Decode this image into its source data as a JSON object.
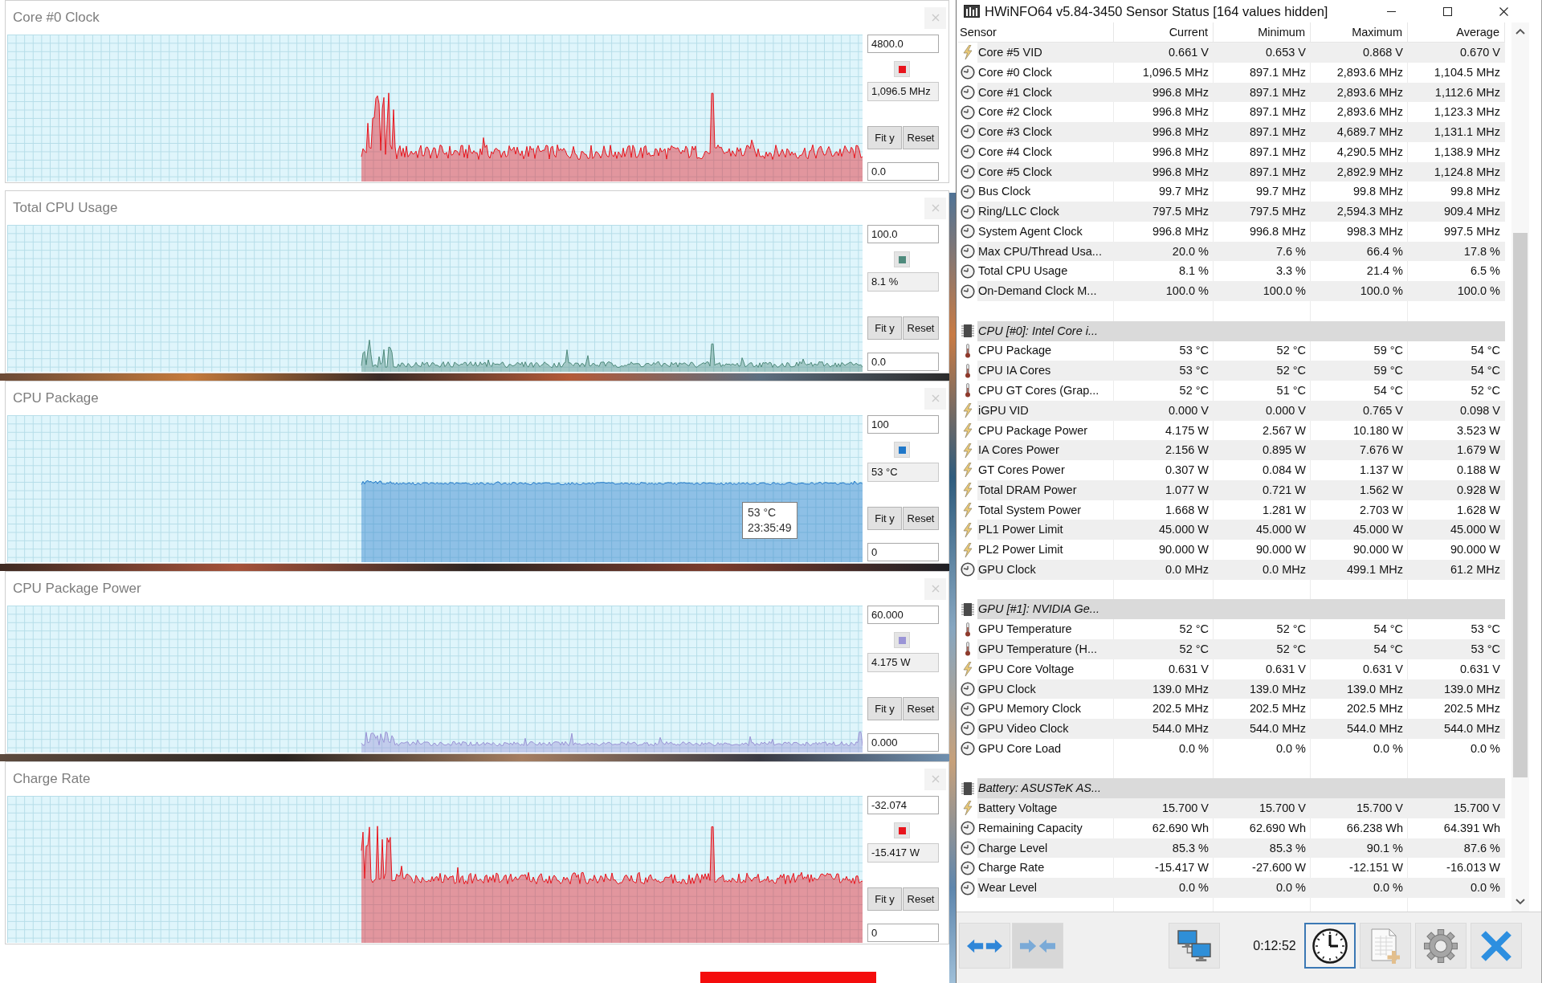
{
  "graphs": [
    {
      "title": "Core #0 Clock",
      "color": "#e8141c",
      "y_max": "4800.0",
      "current": "1,096.5 MHz",
      "y_min": "0.0",
      "buttons": [
        "Fit y",
        "Reset"
      ]
    },
    {
      "title": "Total CPU Usage",
      "color": "#4e8a7c",
      "y_max": "100.0",
      "current": "8.1 %",
      "y_min": "0.0",
      "buttons": [
        "Fit y",
        "Reset"
      ]
    },
    {
      "title": "CPU Package",
      "color": "#1f77c9",
      "y_max": "100",
      "current": "53 °C",
      "y_min": "0",
      "buttons": [
        "Fit y",
        "Reset"
      ],
      "tooltip": {
        "value": "53 °C",
        "time": "23:35:49"
      }
    },
    {
      "title": "CPU Package Power",
      "color": "#9a94d6",
      "y_max": "60.000",
      "current": "4.175 W",
      "y_min": "0.000",
      "buttons": [
        "Fit y",
        "Reset"
      ]
    },
    {
      "title": "Charge Rate",
      "color": "#e8141c",
      "y_max": "-32.074",
      "current": "-15.417 W",
      "y_min": "0",
      "buttons": [
        "Fit y",
        "Reset"
      ]
    }
  ],
  "sensor_window": {
    "title": "HWiNFO64 v5.84-3450 Sensor Status [164 values hidden]",
    "columns": [
      "Sensor",
      "Current",
      "Minimum",
      "Maximum",
      "Average"
    ],
    "groups": [
      {
        "rows": [
          {
            "kind": "bolt",
            "name": "Core #5 VID",
            "values": [
              "0.661 V",
              "0.653 V",
              "0.868 V",
              "0.670 V"
            ]
          },
          {
            "kind": "clock",
            "name": "Core #0 Clock",
            "values": [
              "1,096.5 MHz",
              "897.1 MHz",
              "2,893.6 MHz",
              "1,104.5 MHz"
            ]
          },
          {
            "kind": "clock",
            "name": "Core #1 Clock",
            "values": [
              "996.8 MHz",
              "897.1 MHz",
              "2,893.6 MHz",
              "1,112.6 MHz"
            ]
          },
          {
            "kind": "clock",
            "name": "Core #2 Clock",
            "values": [
              "996.8 MHz",
              "897.1 MHz",
              "2,893.6 MHz",
              "1,123.3 MHz"
            ]
          },
          {
            "kind": "clock",
            "name": "Core #3 Clock",
            "values": [
              "996.8 MHz",
              "897.1 MHz",
              "4,689.7 MHz",
              "1,131.1 MHz"
            ]
          },
          {
            "kind": "clock",
            "name": "Core #4 Clock",
            "values": [
              "996.8 MHz",
              "897.1 MHz",
              "4,290.5 MHz",
              "1,138.9 MHz"
            ]
          },
          {
            "kind": "clock",
            "name": "Core #5 Clock",
            "values": [
              "996.8 MHz",
              "897.1 MHz",
              "2,892.9 MHz",
              "1,124.8 MHz"
            ]
          },
          {
            "kind": "clock",
            "name": "Bus Clock",
            "values": [
              "99.7 MHz",
              "99.7 MHz",
              "99.8 MHz",
              "99.8 MHz"
            ]
          },
          {
            "kind": "clock",
            "name": "Ring/LLC Clock",
            "values": [
              "797.5 MHz",
              "797.5 MHz",
              "2,594.3 MHz",
              "909.4 MHz"
            ]
          },
          {
            "kind": "clock",
            "name": "System Agent Clock",
            "values": [
              "996.8 MHz",
              "996.8 MHz",
              "998.3 MHz",
              "997.5 MHz"
            ]
          },
          {
            "kind": "clock",
            "name": "Max CPU/Thread Usa...",
            "values": [
              "20.0 %",
              "7.6 %",
              "66.4 %",
              "17.8 %"
            ]
          },
          {
            "kind": "clock",
            "name": "Total CPU Usage",
            "values": [
              "8.1 %",
              "3.3 %",
              "21.4 %",
              "6.5 %"
            ]
          },
          {
            "kind": "clock",
            "name": "On-Demand Clock M...",
            "values": [
              "100.0 %",
              "100.0 %",
              "100.0 %",
              "100.0 %"
            ]
          }
        ]
      },
      {
        "title": "CPU [#0]: Intel Core i...",
        "rows": [
          {
            "kind": "thermometer",
            "name": "CPU Package",
            "values": [
              "53 °C",
              "52 °C",
              "59 °C",
              "54 °C"
            ]
          },
          {
            "kind": "thermometer",
            "name": "CPU IA Cores",
            "values": [
              "53 °C",
              "52 °C",
              "59 °C",
              "54 °C"
            ]
          },
          {
            "kind": "thermometer",
            "name": "CPU GT Cores (Grap...",
            "values": [
              "52 °C",
              "51 °C",
              "54 °C",
              "52 °C"
            ]
          },
          {
            "kind": "bolt",
            "name": "iGPU VID",
            "values": [
              "0.000 V",
              "0.000 V",
              "0.765 V",
              "0.098 V"
            ]
          },
          {
            "kind": "bolt",
            "name": "CPU Package Power",
            "values": [
              "4.175 W",
              "2.567 W",
              "10.180 W",
              "3.523 W"
            ]
          },
          {
            "kind": "bolt",
            "name": "IA Cores Power",
            "values": [
              "2.156 W",
              "0.895 W",
              "7.676 W",
              "1.679 W"
            ]
          },
          {
            "kind": "bolt",
            "name": "GT Cores Power",
            "values": [
              "0.307 W",
              "0.084 W",
              "1.137 W",
              "0.188 W"
            ]
          },
          {
            "kind": "bolt",
            "name": "Total DRAM Power",
            "values": [
              "1.077 W",
              "0.721 W",
              "1.562 W",
              "0.928 W"
            ]
          },
          {
            "kind": "bolt",
            "name": "Total System Power",
            "values": [
              "1.668 W",
              "1.281 W",
              "2.703 W",
              "1.628 W"
            ]
          },
          {
            "kind": "bolt",
            "name": "PL1 Power Limit",
            "values": [
              "45.000 W",
              "45.000 W",
              "45.000 W",
              "45.000 W"
            ]
          },
          {
            "kind": "bolt",
            "name": "PL2 Power Limit",
            "values": [
              "90.000 W",
              "90.000 W",
              "90.000 W",
              "90.000 W"
            ]
          },
          {
            "kind": "clock",
            "name": "GPU Clock",
            "values": [
              "0.0 MHz",
              "0.0 MHz",
              "499.1 MHz",
              "61.2 MHz"
            ]
          }
        ]
      },
      {
        "title": "GPU [#1]: NVIDIA Ge...",
        "rows": [
          {
            "kind": "thermometer",
            "name": "GPU Temperature",
            "values": [
              "52 °C",
              "52 °C",
              "54 °C",
              "53 °C"
            ]
          },
          {
            "kind": "thermometer",
            "name": "GPU Temperature (H...",
            "values": [
              "52 °C",
              "52 °C",
              "54 °C",
              "53 °C"
            ]
          },
          {
            "kind": "bolt",
            "name": "GPU Core Voltage",
            "values": [
              "0.631 V",
              "0.631 V",
              "0.631 V",
              "0.631 V"
            ]
          },
          {
            "kind": "clock",
            "name": "GPU Clock",
            "values": [
              "139.0 MHz",
              "139.0 MHz",
              "139.0 MHz",
              "139.0 MHz"
            ]
          },
          {
            "kind": "clock",
            "name": "GPU Memory Clock",
            "values": [
              "202.5 MHz",
              "202.5 MHz",
              "202.5 MHz",
              "202.5 MHz"
            ]
          },
          {
            "kind": "clock",
            "name": "GPU Video Clock",
            "values": [
              "544.0 MHz",
              "544.0 MHz",
              "544.0 MHz",
              "544.0 MHz"
            ]
          },
          {
            "kind": "clock",
            "name": "GPU Core Load",
            "values": [
              "0.0 %",
              "0.0 %",
              "0.0 %",
              "0.0 %"
            ]
          }
        ]
      },
      {
        "title": "Battery: ASUSTeK AS...",
        "rows": [
          {
            "kind": "bolt",
            "name": "Battery Voltage",
            "values": [
              "15.700 V",
              "15.700 V",
              "15.700 V",
              "15.700 V"
            ]
          },
          {
            "kind": "clock",
            "name": "Remaining Capacity",
            "values": [
              "62.690 Wh",
              "62.690 Wh",
              "66.238 Wh",
              "64.391 Wh"
            ]
          },
          {
            "kind": "clock",
            "name": "Charge Level",
            "values": [
              "85.3 %",
              "85.3 %",
              "90.1 %",
              "87.6 %"
            ]
          },
          {
            "kind": "clock",
            "name": "Charge Rate",
            "values": [
              "-15.417 W",
              "-27.600 W",
              "-12.151 W",
              "-16.013 W"
            ]
          },
          {
            "kind": "clock",
            "name": "Wear Level",
            "values": [
              "0.0 %",
              "0.0 %",
              "0.0 %",
              "0.0 %"
            ]
          }
        ]
      }
    ],
    "toolbar": {
      "left": [
        {
          "kind": "expand",
          "disabled": false,
          "focused": false
        },
        {
          "kind": "collapse",
          "disabled": true,
          "focused": false
        }
      ],
      "center": [
        {
          "kind": "network",
          "disabled": false,
          "focused": false
        }
      ],
      "timer": "0:12:52",
      "right": [
        {
          "kind": "clock",
          "disabled": false,
          "focused": true
        },
        {
          "kind": "report",
          "disabled": false,
          "focused": false
        },
        {
          "kind": "settings",
          "disabled": false,
          "focused": false
        },
        {
          "kind": "close",
          "disabled": false,
          "focused": false
        }
      ]
    }
  }
}
